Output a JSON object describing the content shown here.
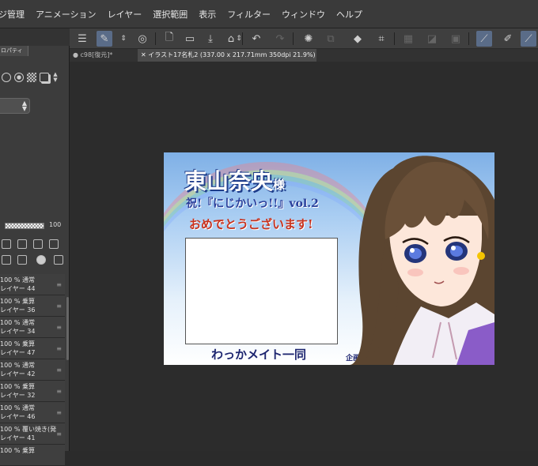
{
  "menu": {
    "items": [
      "ジ管理",
      "アニメーション",
      "レイヤー",
      "選択範囲",
      "表示",
      "フィルター",
      "ウィンドウ",
      "ヘルプ"
    ]
  },
  "left_panel": {
    "tab_label": "ロパティ",
    "opacity_value": "100"
  },
  "layers": [
    {
      "mode": "100 % 通常",
      "name": "レイヤー 44"
    },
    {
      "mode": "100 % 乗算",
      "name": "レイヤー 36"
    },
    {
      "mode": "100 % 通常",
      "name": "レイヤー 34"
    },
    {
      "mode": "100 % 乗算",
      "name": "レイヤー 47"
    },
    {
      "mode": "100 % 通常",
      "name": "レイヤー 42"
    },
    {
      "mode": "100 % 乗算",
      "name": "レイヤー 32"
    },
    {
      "mode": "100 % 通常",
      "name": "レイヤー 46"
    },
    {
      "mode": "100 % 覆い焼き(発",
      "name": "レイヤー 41"
    },
    {
      "mode": "100 % 乗算",
      "name": ""
    }
  ],
  "tabs": [
    {
      "label": "c98[復元]*"
    },
    {
      "label": "イラスト17名札2 (337.00 x 217.71mm 350dpi 21.9%)"
    }
  ],
  "artwork": {
    "name": "東山奈央",
    "name_suffix": "様",
    "event": "祝!『にじかいっ!!』vol.2",
    "congrats": "おめでとうございます!",
    "footer": "わっかメイト一同",
    "credit": "企画/絵　きりま"
  },
  "colors": {
    "accent": "#5a6c88",
    "menu_bg": "#3a3a3a",
    "panel_bg": "#3c3c3c",
    "canvas_bg": "#2c2c2c"
  }
}
